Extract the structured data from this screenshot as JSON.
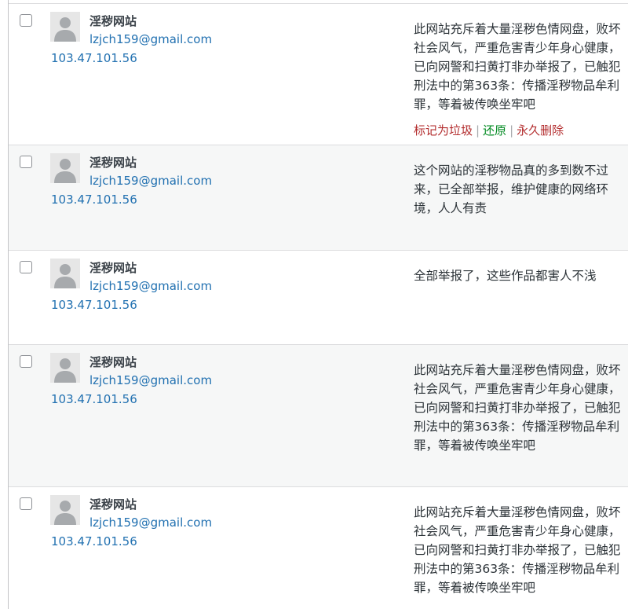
{
  "comments": [
    {
      "author": "淫秽网站",
      "email": "lzjch159@gmail.com",
      "ip": "103.47.101.56",
      "text": "此网站充斥着大量淫秽色情网盘，败坏社会风气，严重危害青少年身心健康，已向网警和扫黄打非办举报了，已触犯刑法中的第363条：传播淫秽物品牟利罪，等着被传唤坐牢吧"
    },
    {
      "author": "淫秽网站",
      "email": "lzjch159@gmail.com",
      "ip": "103.47.101.56",
      "text": "这个网站的淫秽物品真的多到数不过来，已全部举报，维护健康的网络环境，人人有责"
    },
    {
      "author": "淫秽网站",
      "email": "lzjch159@gmail.com",
      "ip": "103.47.101.56",
      "text": "全部举报了，这些作品都害人不浅"
    },
    {
      "author": "淫秽网站",
      "email": "lzjch159@gmail.com",
      "ip": "103.47.101.56",
      "text": "此网站充斥着大量淫秽色情网盘，败坏社会风气，严重危害青少年身心健康，已向网警和扫黄打非办举报了，已触犯刑法中的第363条：传播淫秽物品牟利罪，等着被传唤坐牢吧"
    },
    {
      "author": "淫秽网站",
      "email": "lzjch159@gmail.com",
      "ip": "103.47.101.56",
      "text": "此网站充斥着大量淫秽色情网盘，败坏社会风气，严重危害青少年身心健康，已向网警和扫黄打非办举报了，已触犯刑法中的第363条：传播淫秽物品牟利罪，等着被传唤坐牢吧"
    }
  ],
  "row_actions": {
    "mark_spam": "标记为垃圾",
    "separator": "|",
    "restore": "还原",
    "delete_permanently": "永久删除"
  },
  "icons": {
    "avatar": "default-avatar-icon",
    "checkbox": "checkbox"
  },
  "colors": {
    "link": "#2271b1",
    "spam": "#b32d2e",
    "restore": "#008a20",
    "alt_row": "#f6f7f7"
  }
}
